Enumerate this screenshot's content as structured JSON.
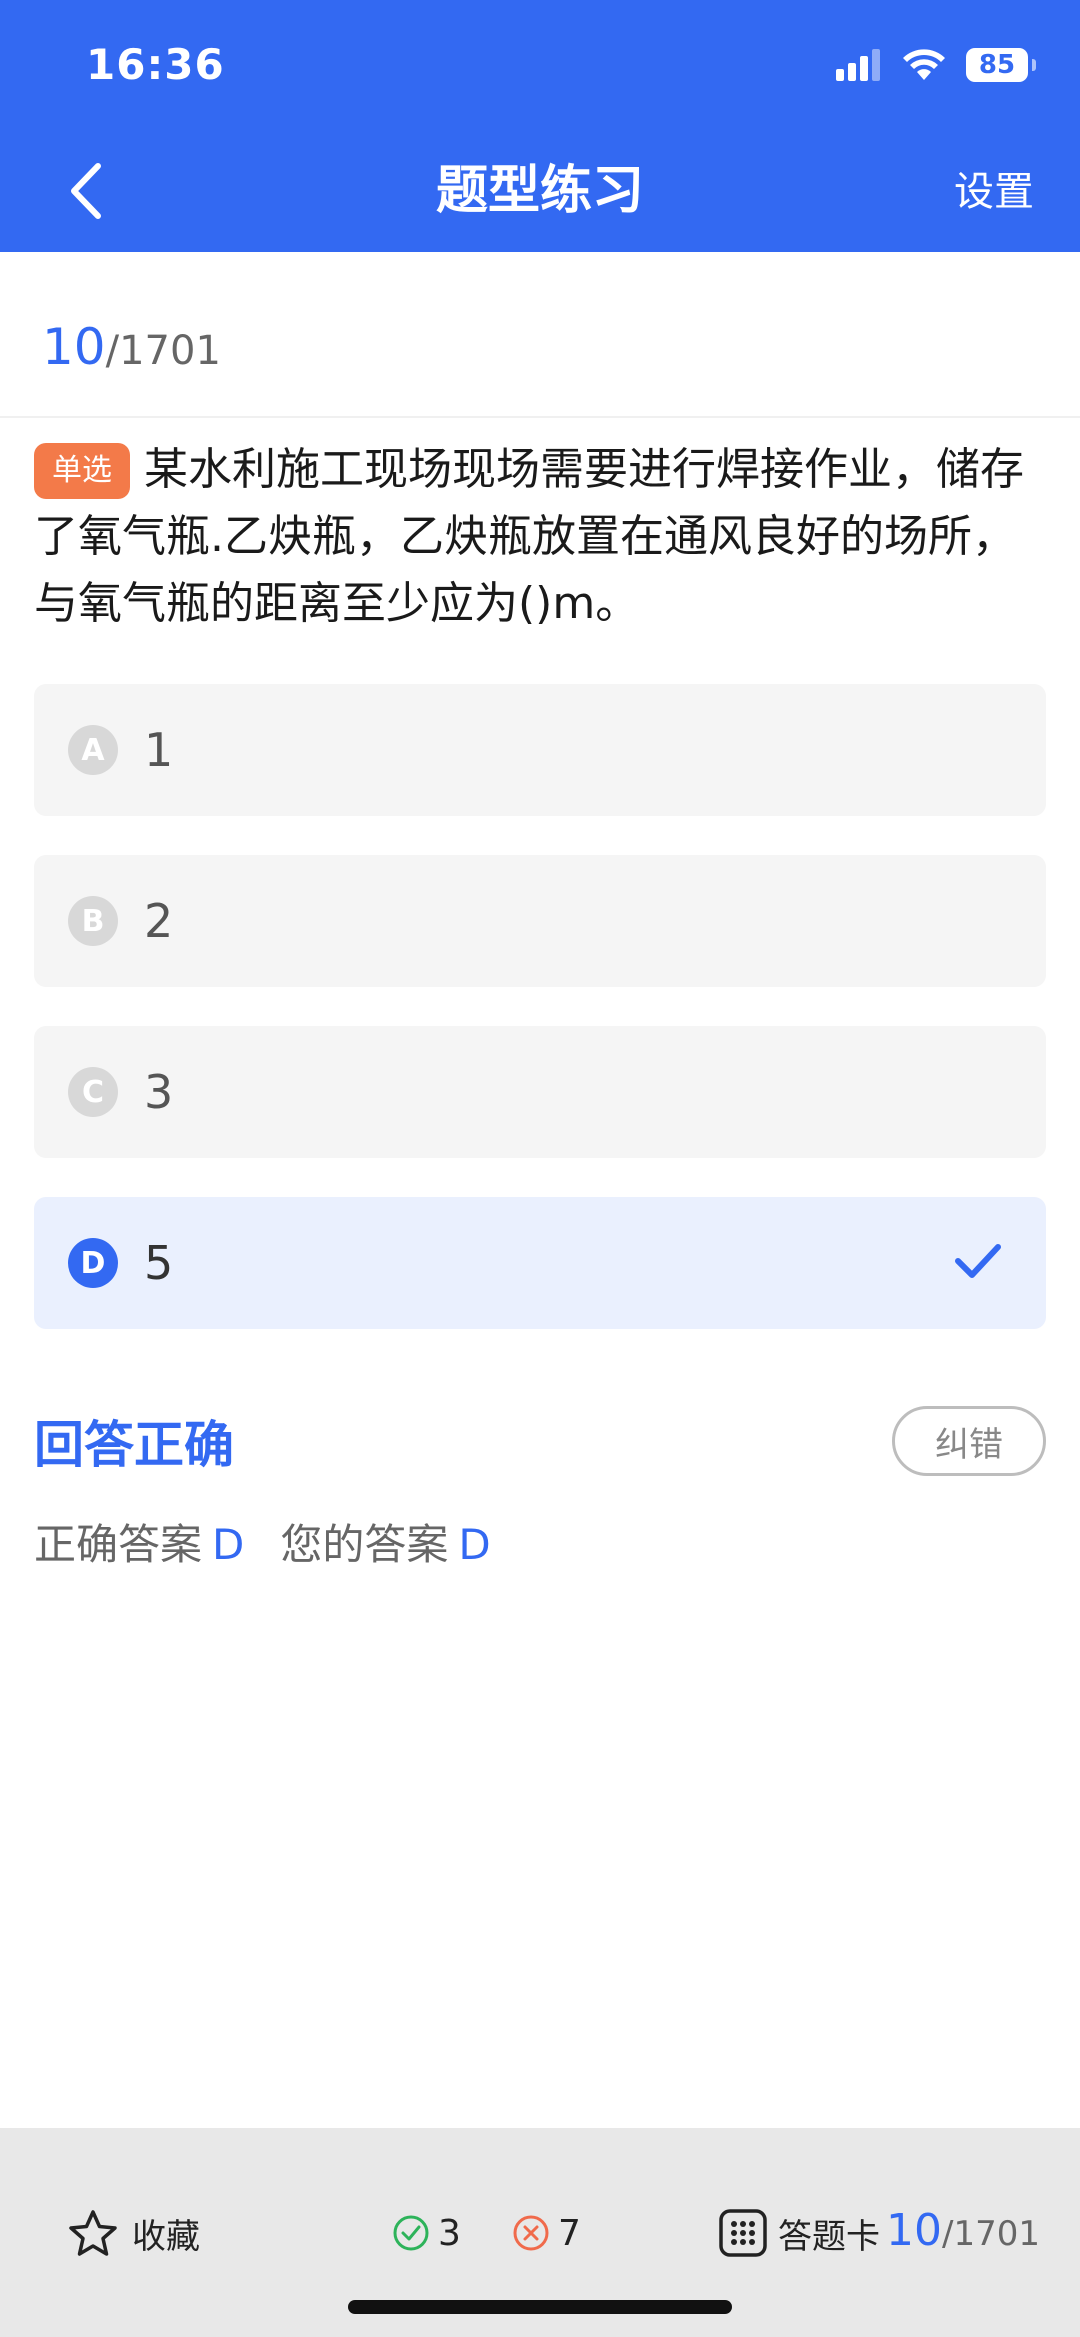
{
  "status_bar": {
    "time": "16:36",
    "battery": "85",
    "icons": [
      "signal-icon",
      "wifi-icon",
      "battery-icon"
    ]
  },
  "nav": {
    "title": "题型练习",
    "settings_label": "设置",
    "back_icon": "chevron-left-icon"
  },
  "progress": {
    "current": "10",
    "total": "/1701"
  },
  "question": {
    "type_badge": "单选",
    "text": "某水利施工现场现场需要进行焊接作业，储存了氧气瓶.乙炔瓶，乙炔瓶放置在通风良好的场所，与氧气瓶的距离至少应为()m。"
  },
  "options": [
    {
      "letter": "A",
      "text": "1",
      "selected": false
    },
    {
      "letter": "B",
      "text": "2",
      "selected": false
    },
    {
      "letter": "C",
      "text": "3",
      "selected": false
    },
    {
      "letter": "D",
      "text": "5",
      "selected": true
    }
  ],
  "result": {
    "title": "回答正确",
    "report_label": "纠错",
    "correct_label": "正确答案",
    "correct_value": "D",
    "your_label": "您的答案",
    "your_value": "D"
  },
  "bottom_bar": {
    "favorite_label": "收藏",
    "correct_count": "3",
    "wrong_count": "7",
    "card_label": "答题卡",
    "current": "10",
    "total": "/1701"
  },
  "colors": {
    "primary": "#3369F2",
    "badge": "#F37A49",
    "correct": "#2DB35A",
    "wrong": "#F06A4B"
  }
}
